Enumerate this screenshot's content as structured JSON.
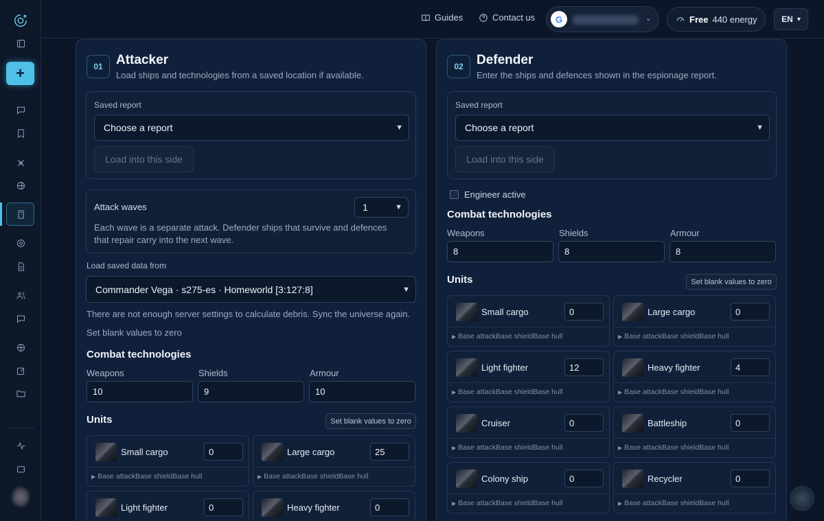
{
  "topbar": {
    "guides": "Guides",
    "contact": "Contact us",
    "account_initial": "G",
    "energy_free": "Free",
    "energy_amount": "440 energy",
    "language": "EN"
  },
  "attacker": {
    "step": "01",
    "title": "Attacker",
    "subtitle": "Load ships and technologies from a saved location if available.",
    "saved_report_label": "Saved report",
    "saved_report_value": "Choose a report",
    "load_button": "Load into this side",
    "attack_waves_label": "Attack waves",
    "attack_waves_value": "1",
    "attack_waves_help": "Each wave is a separate attack. Defender ships that survive and defences that repair carry into the next wave.",
    "load_saved_label": "Load saved data from",
    "load_saved_value": "Commander Vega · s275-es · Homeworld [3:127:8]",
    "debris_warning": "There are not enough server settings to calculate debris. Sync the universe again.",
    "blank_zero_link": "Set blank values to zero",
    "combat_tech_heading": "Combat technologies",
    "tech": {
      "weapons_label": "Weapons",
      "weapons_value": "10",
      "shields_label": "Shields",
      "shields_value": "9",
      "armour_label": "Armour",
      "armour_value": "10"
    },
    "units_heading": "Units",
    "units_blank_button": "Set blank values to zero",
    "units": [
      {
        "name": "Small cargo",
        "value": "0",
        "base": "Base attackBase shieldBase hull"
      },
      {
        "name": "Large cargo",
        "value": "25",
        "base": "Base attackBase shieldBase hull"
      },
      {
        "name": "Light fighter",
        "value": "0",
        "base": "Base attackBase shieldBase hull"
      },
      {
        "name": "Heavy fighter",
        "value": "0",
        "base": "Base attackBase shieldBase hull"
      }
    ]
  },
  "defender": {
    "step": "02",
    "title": "Defender",
    "subtitle": "Enter the ships and defences shown in the espionage report.",
    "saved_report_label": "Saved report",
    "saved_report_value": "Choose a report",
    "load_button": "Load into this side",
    "engineer_label": "Engineer active",
    "combat_tech_heading": "Combat technologies",
    "tech": {
      "weapons_label": "Weapons",
      "weapons_value": "8",
      "shields_label": "Shields",
      "shields_value": "8",
      "armour_label": "Armour",
      "armour_value": "8"
    },
    "units_heading": "Units",
    "units_blank_button": "Set blank values to zero",
    "units": [
      {
        "name": "Small cargo",
        "value": "0",
        "base": "Base attackBase shieldBase hull"
      },
      {
        "name": "Large cargo",
        "value": "0",
        "base": "Base attackBase shieldBase hull"
      },
      {
        "name": "Light fighter",
        "value": "12",
        "base": "Base attackBase shieldBase hull"
      },
      {
        "name": "Heavy fighter",
        "value": "4",
        "base": "Base attackBase shieldBase hull"
      },
      {
        "name": "Cruiser",
        "value": "0",
        "base": "Base attackBase shieldBase hull"
      },
      {
        "name": "Battleship",
        "value": "0",
        "base": "Base attackBase shieldBase hull"
      },
      {
        "name": "Colony ship",
        "value": "0",
        "base": "Base attackBase shieldBase hull"
      },
      {
        "name": "Recycler",
        "value": "0",
        "base": "Base attackBase shieldBase hull"
      }
    ]
  }
}
